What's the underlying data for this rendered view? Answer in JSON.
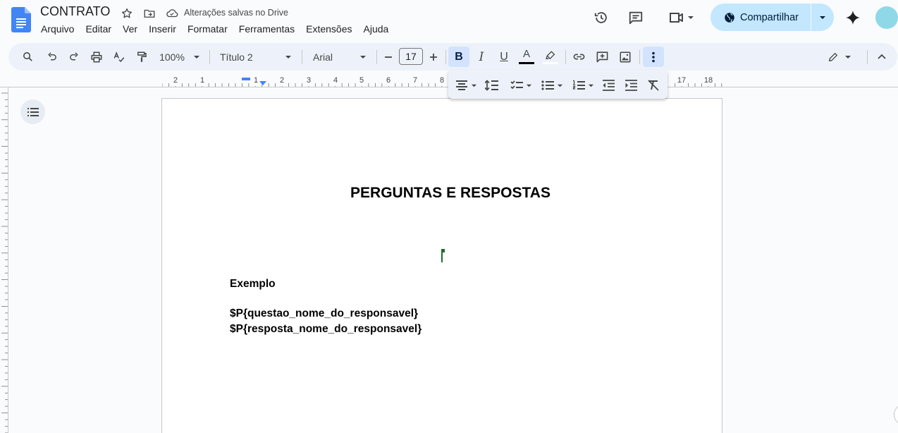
{
  "document": {
    "title": "CONTRATO",
    "save_status": "Alterações salvas no Drive"
  },
  "menu": [
    "Arquivo",
    "Editar",
    "Ver",
    "Inserir",
    "Formatar",
    "Ferramentas",
    "Extensões",
    "Ajuda"
  ],
  "header": {
    "share_label": "Compartilhar"
  },
  "toolbar": {
    "zoom": "100%",
    "style": "Título 2",
    "font": "Arial",
    "font_size": "17",
    "bold": "B",
    "italic": "I",
    "underline": "U",
    "text_color_letter": "A"
  },
  "ruler": {
    "labels": [
      "2",
      "1",
      "1",
      "2",
      "3",
      "4",
      "5",
      "6",
      "7",
      "8",
      "17",
      "18"
    ]
  },
  "page": {
    "heading": "PERGUNTAS E RESPOSTAS",
    "lines": [
      "Exemplo",
      "$P{questao_nome_do_responsavel}",
      "$P{resposta_nome_do_responsavel}"
    ]
  },
  "colors": {
    "accent": "#0b57d0",
    "share_bg": "#c2e7ff",
    "toolbar_bg": "#edf2fa",
    "cursor": "#1e6b32"
  }
}
